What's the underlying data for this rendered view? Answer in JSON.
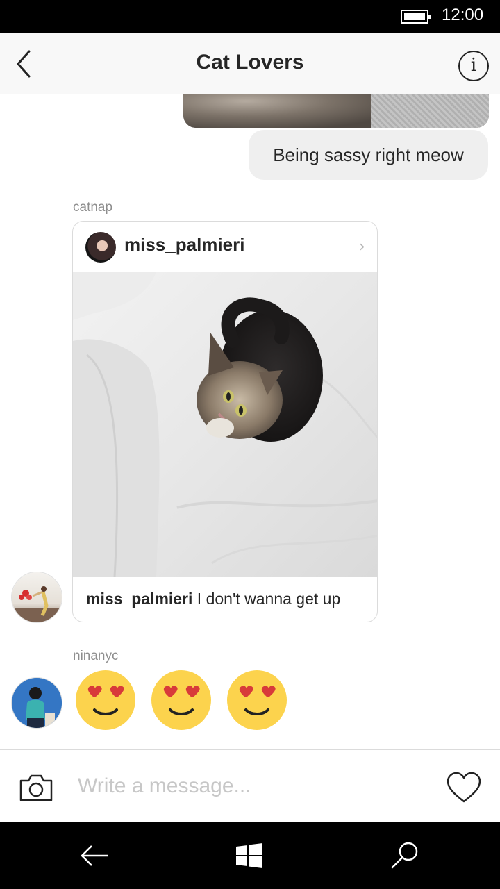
{
  "status_bar": {
    "time": "12:00",
    "battery_icon": "battery-full-icon"
  },
  "header": {
    "title": "Cat Lovers",
    "back_icon": "chevron-left-icon",
    "info_icon": "info-icon",
    "info_glyph": "i"
  },
  "messages": {
    "my_text": "Being sassy right meow",
    "shared_post": {
      "sender": "catnap",
      "post_author": "miss_palmieri",
      "caption_author": "miss_palmieri",
      "caption_text": " I don't wanna get up",
      "chevron": "›"
    },
    "emoji_message": {
      "sender": "ninanyc",
      "emojis": [
        "heart-eyes-emoji",
        "heart-eyes-emoji",
        "heart-eyes-emoji"
      ]
    }
  },
  "composer": {
    "placeholder": "Write a message...",
    "camera_icon": "camera-icon",
    "like_icon": "heart-icon"
  },
  "nav_bar": {
    "items": [
      "back-arrow-icon",
      "windows-icon",
      "search-icon"
    ]
  },
  "colors": {
    "bubble": "#efefef",
    "emoji_face": "#fcd34d",
    "heart": "#d83a3a",
    "text": "#262626",
    "muted": "#8e8e8e"
  }
}
